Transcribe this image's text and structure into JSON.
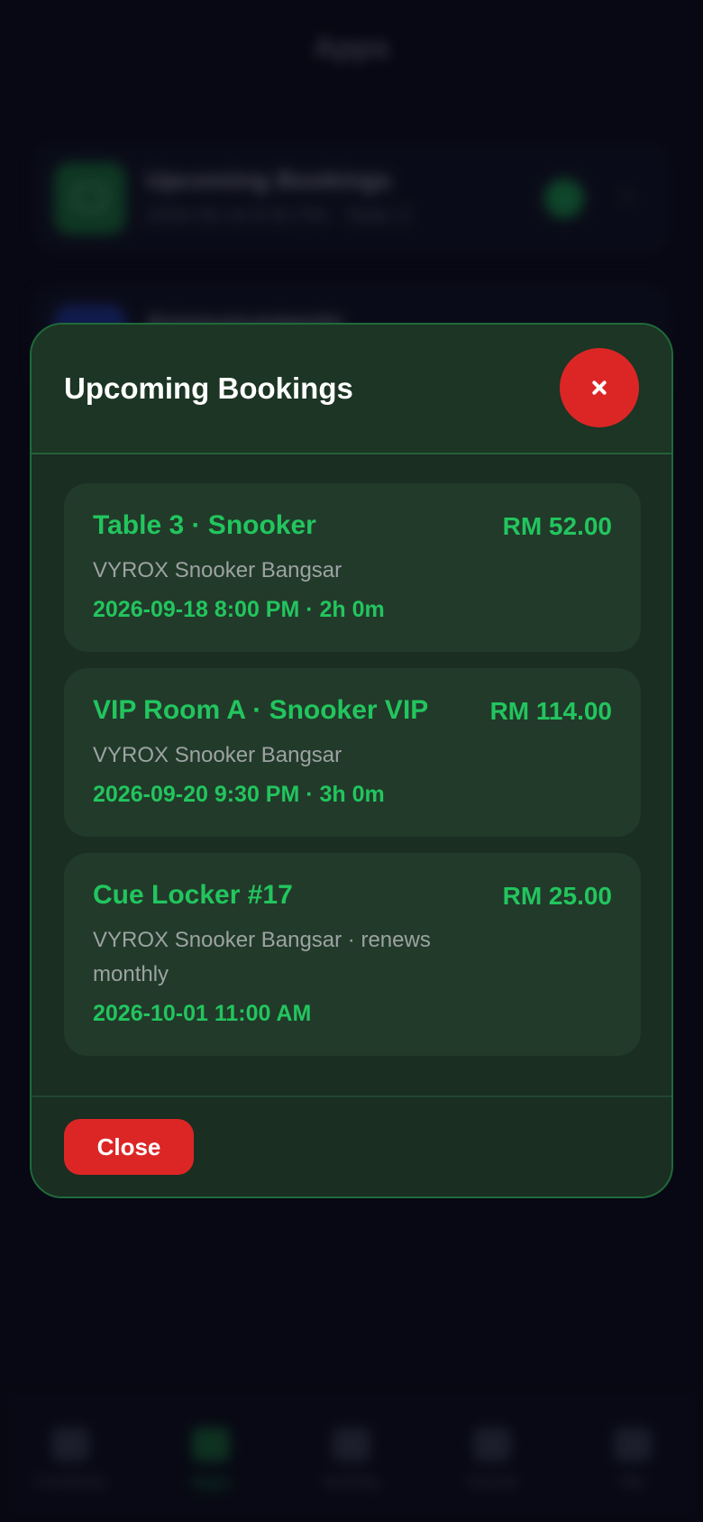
{
  "background": {
    "title": "Apps",
    "cards": [
      {
        "title": "Upcoming Bookings",
        "subtitle": "2026-09-18 8:00 PM · Table 3"
      },
      {
        "title": "Announcements",
        "subtitle": ""
      }
    ],
    "tabs": [
      {
        "label": "Contacts",
        "icon": "folder-icon"
      },
      {
        "label": "Apps",
        "icon": "apps-icon",
        "active": true
      },
      {
        "label": "Activity",
        "icon": "activity-icon"
      },
      {
        "label": "Social",
        "icon": "chat-icon"
      },
      {
        "label": "Me",
        "icon": "person-icon"
      }
    ]
  },
  "modal": {
    "title": "Upcoming Bookings",
    "close_icon": "close-icon",
    "bookings": [
      {
        "title": "Table 3 · Snooker",
        "price": "RM 52.00",
        "venue": "VYROX Snooker Bangsar",
        "time": "2026-09-18 8:00 PM · 2h 0m"
      },
      {
        "title": "VIP Room A · Snooker VIP",
        "price": "RM 114.00",
        "venue": "VYROX Snooker Bangsar",
        "time": "2026-09-20 9:30 PM · 3h 0m"
      },
      {
        "title": "Cue Locker #17",
        "price": "RM 25.00",
        "venue": "VYROX Snooker Bangsar · renews monthly",
        "time": "2026-10-01 11:00 AM"
      }
    ],
    "close_label": "Close"
  },
  "colors": {
    "accent_green": "#22c55e",
    "danger_red": "#dc2626",
    "modal_bg": "#1a2e22"
  }
}
